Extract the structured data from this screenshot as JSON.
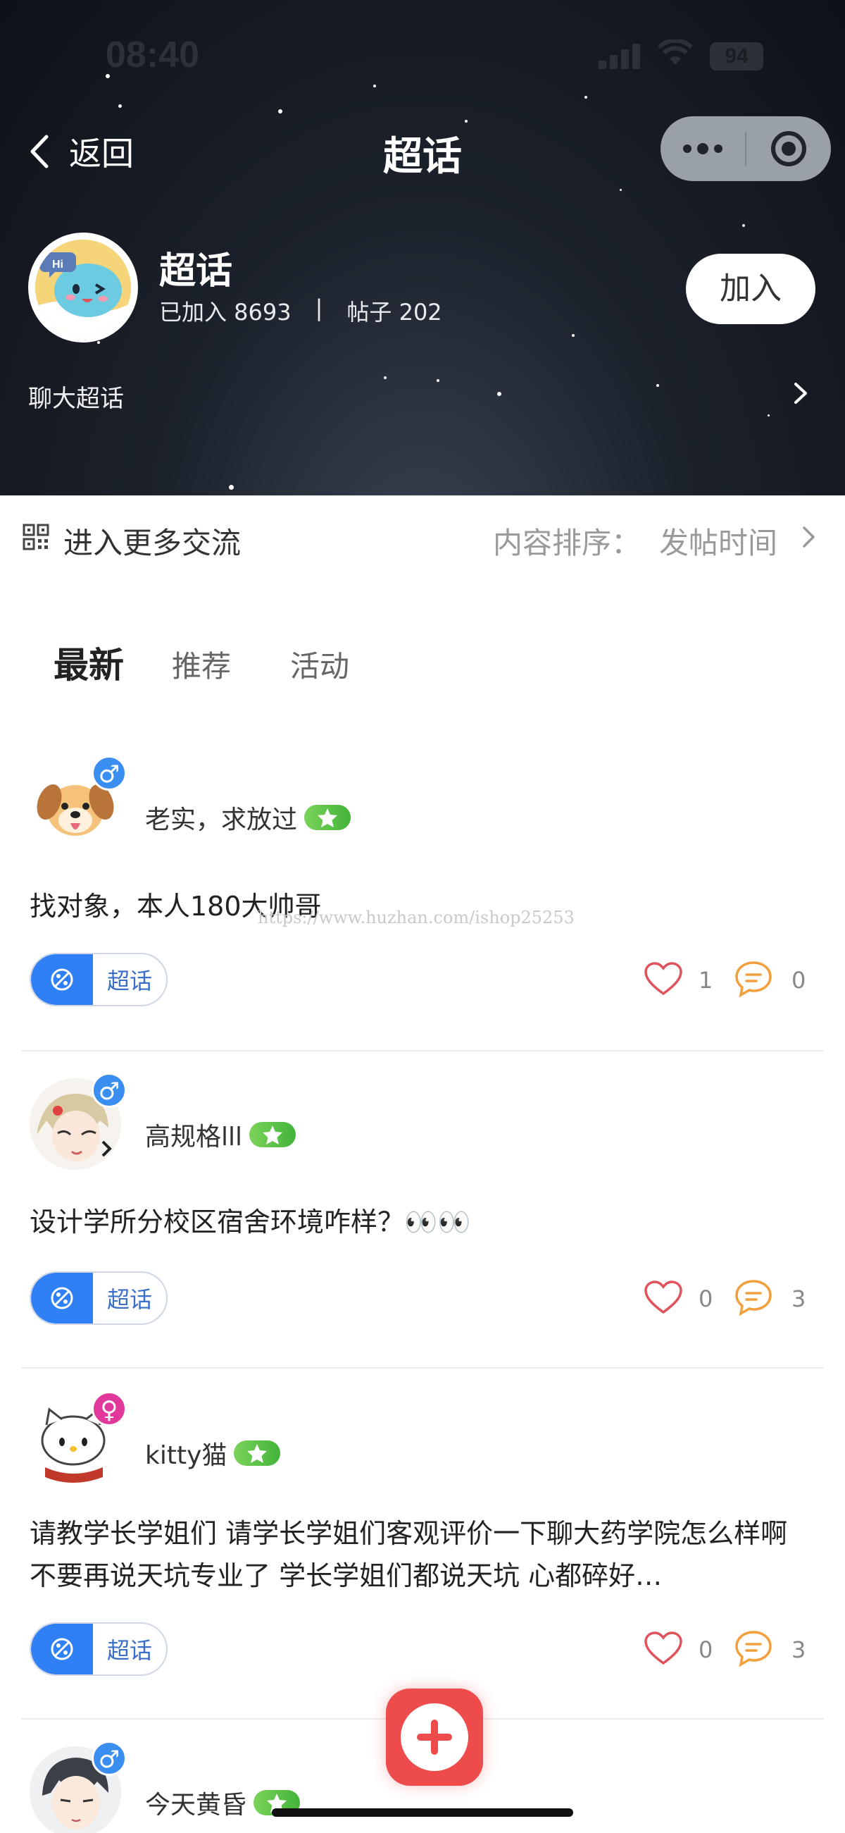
{
  "status_bar": {
    "time": "08:40",
    "battery": "94"
  },
  "nav": {
    "back_label": "返回",
    "title": "超话"
  },
  "topic": {
    "name": "超话",
    "joined": "已加入 8693",
    "separator": "|",
    "posts": "帖子 202",
    "join_label": "加入",
    "description": "聊大超话"
  },
  "toolbar": {
    "more_communication": "进入更多交流",
    "sort_label": "内容排序：",
    "sort_value": "发帖时间"
  },
  "tabs": [
    {
      "label": "最新",
      "active": true
    },
    {
      "label": "推荐",
      "active": false
    },
    {
      "label": "活动",
      "active": false
    }
  ],
  "watermark": "https://www.huzhan.com/ishop25253",
  "posts": [
    {
      "author": "老实，求放过",
      "gender": "♂",
      "text": "找对象，本人180大帅哥",
      "tag": "超话",
      "likes": "1",
      "comments": "0"
    },
    {
      "author": "高规格lll",
      "gender": "♂",
      "text": "设计学所分校区宿舍环境咋样？👀👀",
      "tag": "超话",
      "likes": "0",
      "comments": "3"
    },
    {
      "author": "kitty猫",
      "gender": "♀",
      "text": "请教学长学姐们 请学长学姐们客观评价一下聊大药学院怎么样啊 不要再说天坑专业了 学长学姐们都说天坑 心都碎好…",
      "tag": "超话",
      "likes": "0",
      "comments": "3"
    },
    {
      "author": "今天黄昏",
      "gender": "♂"
    }
  ],
  "colors": {
    "accent_blue": "#2f7ff5",
    "fab_red": "#ee4c4c",
    "heart_red": "#e0525c",
    "comment_orange": "#f2a03d",
    "badge_green": "#5cc24a"
  }
}
